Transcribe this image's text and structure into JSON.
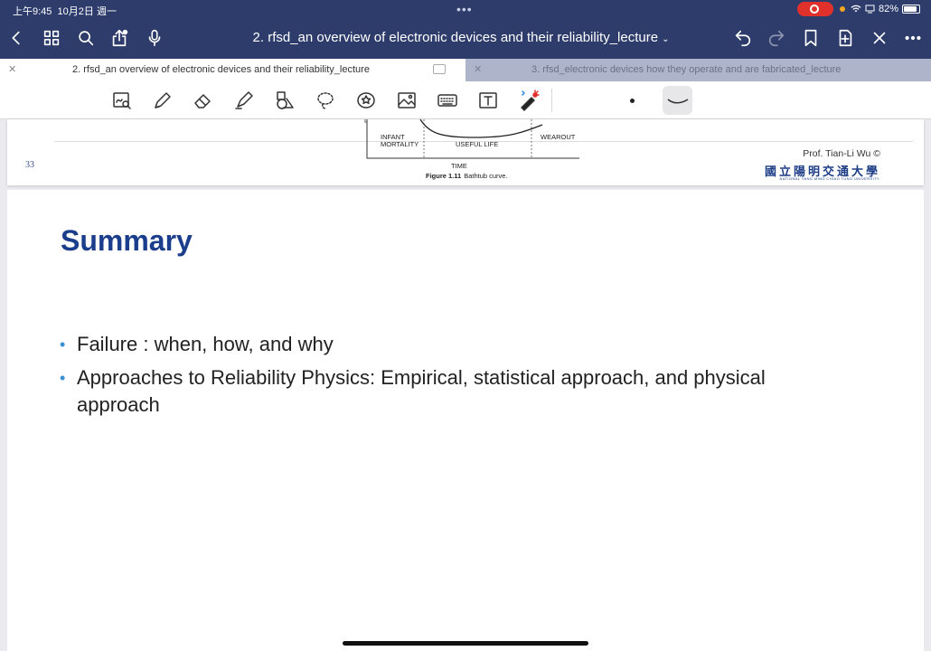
{
  "status_bar": {
    "time": "上午9:45",
    "date": "10月2日 週一",
    "battery": "82%"
  },
  "app_bar": {
    "title": "2. rfsd_an overview of electronic devices and their reliability_lecture",
    "icons": [
      "back-icon",
      "grid-icon",
      "search-icon",
      "share-icon",
      "microphone-icon",
      "undo-icon",
      "redo-icon",
      "bookmark-icon",
      "add-page-icon",
      "close-icon",
      "more-icon"
    ]
  },
  "tabs": [
    {
      "label": "2. rfsd_an overview of electronic devices and their reliability_lecture",
      "active": true
    },
    {
      "label": "3. rfsd_electronic devices how they operate and are fabricated_lecture",
      "active": false
    }
  ],
  "toolbar": {
    "tools": [
      "lasso-zoom-icon",
      "pen-icon",
      "eraser-icon",
      "highlighter-icon",
      "shapes-icon",
      "lasso-icon",
      "sticker-icon",
      "image-icon",
      "keyboard-icon",
      "text-box-icon",
      "laser-pointer-icon"
    ]
  },
  "previous_page": {
    "slide_number": "33",
    "figure": {
      "label_left": "INFANT\nMORTALITY",
      "label_middle": "USEFUL LIFE",
      "label_right": "WEAROUT",
      "x_axis": "TIME",
      "caption_bold": "Figure 1.11",
      "caption": "Bathtub curve."
    },
    "author": "Prof. Tian-Li Wu ©",
    "university_zh": "國立陽明交通大學",
    "university_en": "NATIONAL YANG MING CHIAO TUNG UNIVERSITY"
  },
  "slide": {
    "title": "Summary",
    "bullets": [
      "Failure : when, how, and why",
      "Approaches to Reliability Physics:  Empirical, statistical approach, and physical approach"
    ]
  },
  "colors": {
    "app_bar": "#2d3c6b",
    "title_blue": "#1b3e8c",
    "bullet_blue": "#3b8fd6",
    "record_red": "#e0312c"
  }
}
